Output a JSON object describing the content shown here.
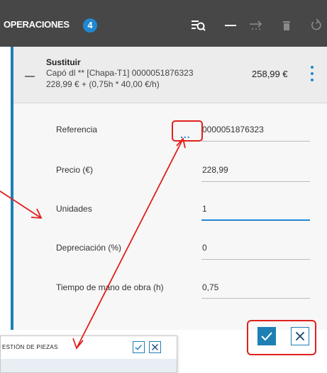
{
  "header": {
    "title": "OPERACIONES",
    "badge": "4",
    "icons": [
      "search-list-icon",
      "minimize-icon",
      "transfer-icon",
      "trash-icon",
      "undo-icon"
    ]
  },
  "operation": {
    "name": "Sustituir",
    "description": "Capó dl ** [Chapa-T1] 0000051876323",
    "formula": "228,99 € + (0,75h * 40,00 €/h)",
    "price": "258,99 €"
  },
  "form": {
    "referencia_label": "Referencia",
    "referencia_value": "0000051876323",
    "precio_label": "Precio (€)",
    "precio_value": "228,99",
    "unidades_label": "Unidades",
    "unidades_value": "1",
    "depreciacion_label": "Depreciación (%)",
    "depreciacion_value": "0",
    "tiempo_label": "Tiempo de mano de obra (h)",
    "tiempo_value": "0,75",
    "ellipsis": "..."
  },
  "popup": {
    "title": "ESTIÓN DE PIEZAS"
  },
  "colors": {
    "header_bg": "#474747",
    "accent": "#1e88d2",
    "highlight": "#e0201c"
  }
}
